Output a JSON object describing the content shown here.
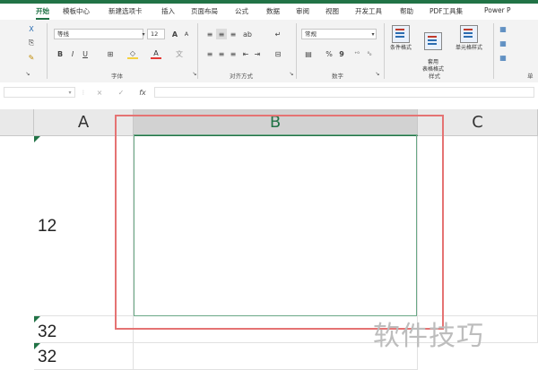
{
  "ribbon_tabs": [
    "开始",
    "模板中心",
    "新建选项卡",
    "插入",
    "页面布局",
    "公式",
    "数据",
    "审阅",
    "视图",
    "开发工具",
    "帮助",
    "PDF工具集",
    "Power P"
  ],
  "active_tab": "开始",
  "font": {
    "name": "等线",
    "size": "12",
    "bold": "B",
    "italic": "I",
    "underline": "U",
    "grow": "A",
    "shrink": "A",
    "color_glyph": "A",
    "group": "字体"
  },
  "alignment": {
    "group": "对齐方式",
    "orient": "ab"
  },
  "number": {
    "format": "常规",
    "percent": "%",
    "comma": "9",
    "group": "数字"
  },
  "styles": {
    "group": "样式",
    "cond_format": "条件格式",
    "table_format": "套用\n表格格式",
    "cell_styles": "单元格样式"
  },
  "clipboard": {
    "cut": "X",
    "copy": "⎘",
    "paint": "✎"
  },
  "cells_group": "单",
  "formula_bar": {
    "name_box": "",
    "cancel": "×",
    "enter": "✓",
    "fx": "fx",
    "value": ""
  },
  "columns": [
    "A",
    "B",
    "C"
  ],
  "cells": {
    "a_row1": "12",
    "a_row2": "32",
    "a_row3": "32"
  },
  "watermark": "软件技巧",
  "colors": {
    "accent": "#217346",
    "frame": "#e57373",
    "selection": "#6aa886"
  }
}
